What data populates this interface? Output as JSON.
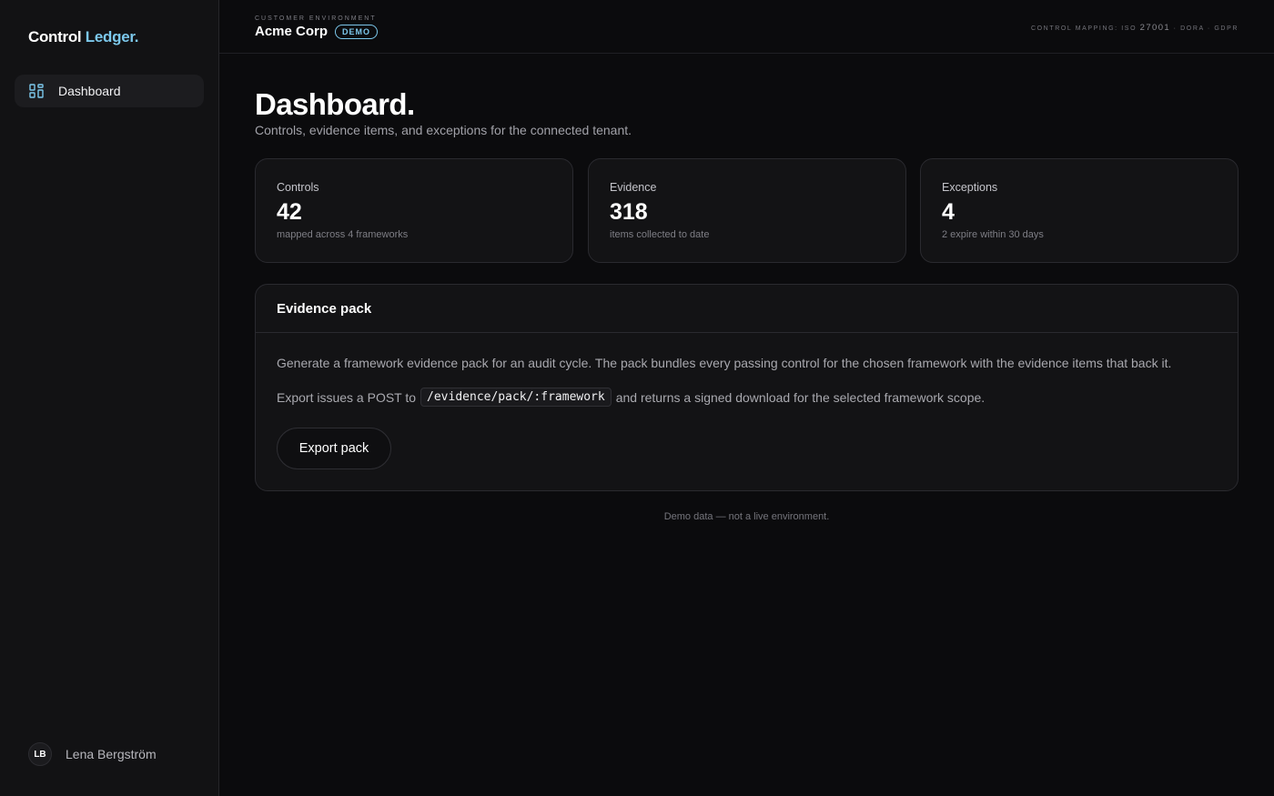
{
  "brand": {
    "name_part1": "Control",
    "name_part2": "Ledger."
  },
  "sidebar": {
    "items": [
      {
        "label": "Dashboard",
        "icon": "dashboard-grid-icon",
        "active": true
      }
    ],
    "user": {
      "initials": "LB",
      "name": "Lena Bergström"
    }
  },
  "topbar": {
    "env_kicker": "Customer Environment",
    "env_name": "Acme Corp",
    "badge": "DEMO",
    "mapping_prefix": "Control mapping: ISO",
    "mapping_iso": "27001",
    "mapping_rest": "· DORA · GDPR"
  },
  "page": {
    "title": "Dashboard.",
    "subtitle": "Controls, evidence items, and exceptions for the connected tenant."
  },
  "stats": [
    {
      "label": "Controls",
      "value": "42",
      "note": "mapped across 4 frameworks"
    },
    {
      "label": "Evidence",
      "value": "318",
      "note": "items collected to date"
    },
    {
      "label": "Exceptions",
      "value": "4",
      "note": "2 expire within 30 days"
    }
  ],
  "evidence_pack": {
    "title": "Evidence pack",
    "description": "Generate a framework evidence pack for an audit cycle. The pack bundles every passing control for the chosen framework with the evidence items that back it.",
    "export_prefix": "Export issues a POST to",
    "endpoint": "/evidence/pack/:framework",
    "export_suffix": "and returns a signed download for the selected framework scope.",
    "button_label": "Export pack"
  },
  "footer_note": "Demo data — not a live environment.",
  "colors": {
    "accent": "#7cc8ec",
    "background": "#0b0b0d",
    "surface": "#131315"
  }
}
